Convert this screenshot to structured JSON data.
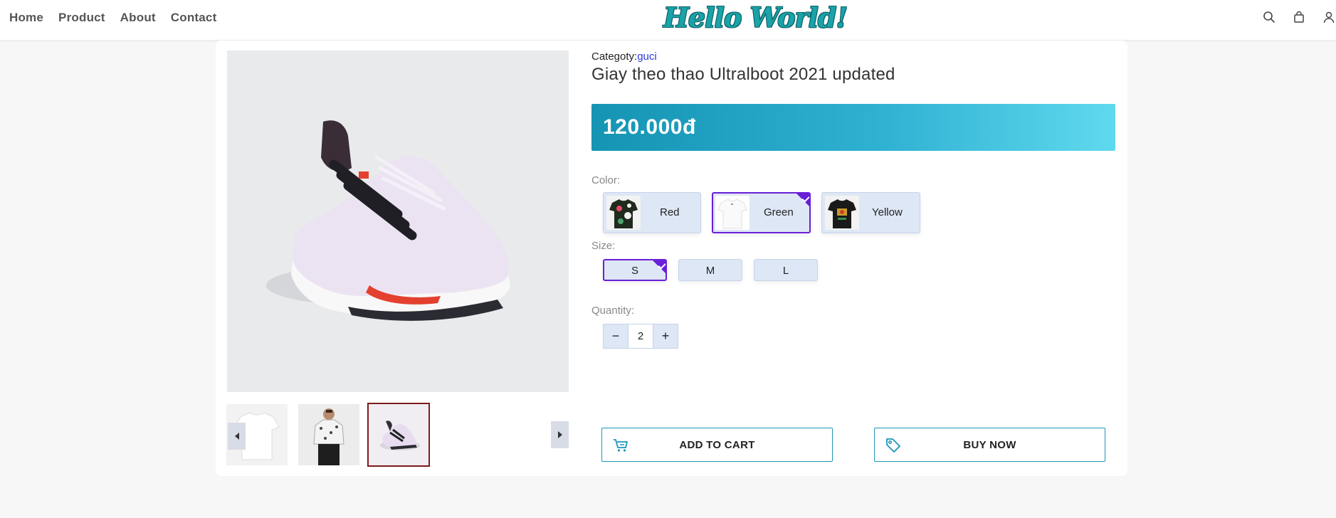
{
  "header": {
    "nav": [
      "Home",
      "Product",
      "About",
      "Contact"
    ],
    "logo": "Hello World!",
    "icons": [
      "search-icon",
      "shopping-bag-icon",
      "user-icon"
    ]
  },
  "product": {
    "category_label": "Categoty:",
    "category_value": "guci",
    "title": "Giay theo thao Ultralboot 2021 updated",
    "price": "120.000đ",
    "color_label": "Color:",
    "colors": [
      {
        "name": "Red",
        "selected": false
      },
      {
        "name": "Green",
        "selected": true
      },
      {
        "name": "Yellow",
        "selected": false
      }
    ],
    "size_label": "Size:",
    "sizes": [
      {
        "name": "S",
        "selected": true
      },
      {
        "name": "M",
        "selected": false
      },
      {
        "name": "L",
        "selected": false
      }
    ],
    "quantity_label": "Quantity:",
    "quantity": "2",
    "minus": "−",
    "plus": "+",
    "add_to_cart": "ADD TO CART",
    "buy_now": "BUY NOW"
  },
  "colors": {
    "accent": "#1d95b8",
    "selected": "#6a1fd8",
    "option_bg": "#dde7f5",
    "thumb_selected_border": "#7d1b1b"
  }
}
